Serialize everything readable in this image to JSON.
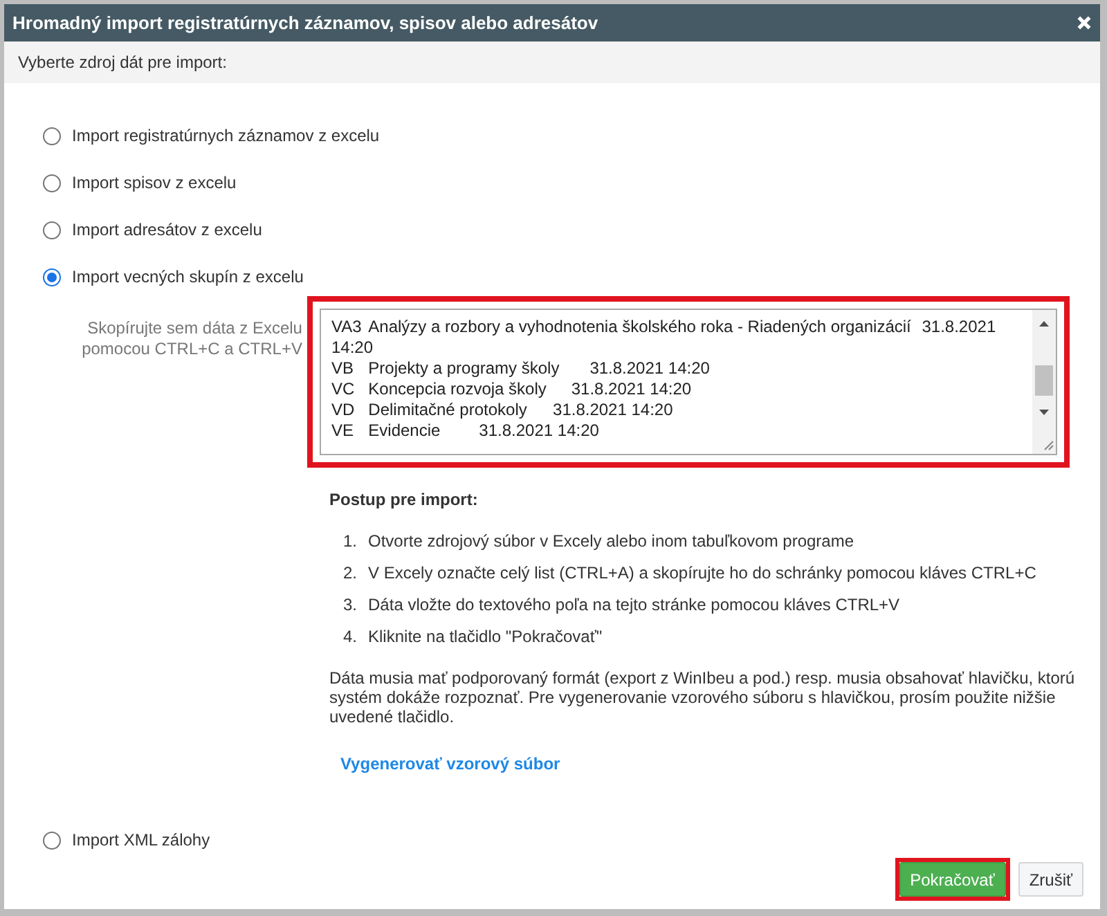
{
  "window": {
    "title": "Hromadný import registratúrnych záznamov, spisov alebo adresátov"
  },
  "prompt": "Vyberte zdroj dát pre import:",
  "sources": [
    {
      "label": "Import registratúrnych záznamov z excelu",
      "selected": false
    },
    {
      "label": "Import spisov z excelu",
      "selected": false
    },
    {
      "label": "Import adresátov z excelu",
      "selected": false
    },
    {
      "label": "Import vecných skupín z excelu",
      "selected": true
    }
  ],
  "paste": {
    "label": "Skopírujte sem dáta z Excelu pomocou CTRL+C a CTRL+V",
    "lines": [
      "VA3\tAnalýzy a rozbory a vyhodnotenia školského roka - Riadených organizácií\t31.8.2021 14:20",
      "VB\tProjekty a programy školy\t\t31.8.2021 14:20",
      "VC\tKoncepcia rozvoja školy\t\t31.8.2021 14:20",
      "VD\tDelimitačné protokoly\t\t31.8.2021 14:20",
      "VE\tEvidencie\t\t31.8.2021 14:20"
    ]
  },
  "procedure": {
    "title": "Postup pre import:",
    "steps": [
      {
        "number": "1.",
        "text": "Otvorte zdrojový súbor v Excely alebo inom tabuľkovom programe"
      },
      {
        "number": "2.",
        "text": "V Excely označte celý list (CTRL+A) a skopírujte ho do schránky pomocou kláves CTRL+C"
      },
      {
        "number": "3.",
        "text": "Dáta vložte do textového poľa na tejto stránke pomocou kláves CTRL+V"
      },
      {
        "number": "4.",
        "text": "Kliknite na tlačidlo \"Pokračovať\""
      }
    ],
    "note": "Dáta musia mať podporovaný formát (export z WinIbeu a pod.) resp. musia obsahovať hlavičku, ktorú systém dokáže rozpoznať. Pre vygenerovanie vzorového súboru s hlavičkou, prosím použite nižšie uvedené tlačidlo.",
    "link": "Vygenerovať vzorový súbor"
  },
  "xml_source": {
    "label": "Import XML zálohy",
    "selected": false
  },
  "buttons": [
    {
      "label": "Pokračovať",
      "kind": "primary"
    },
    {
      "label": "Zrušiť",
      "kind": "secondary"
    }
  ]
}
